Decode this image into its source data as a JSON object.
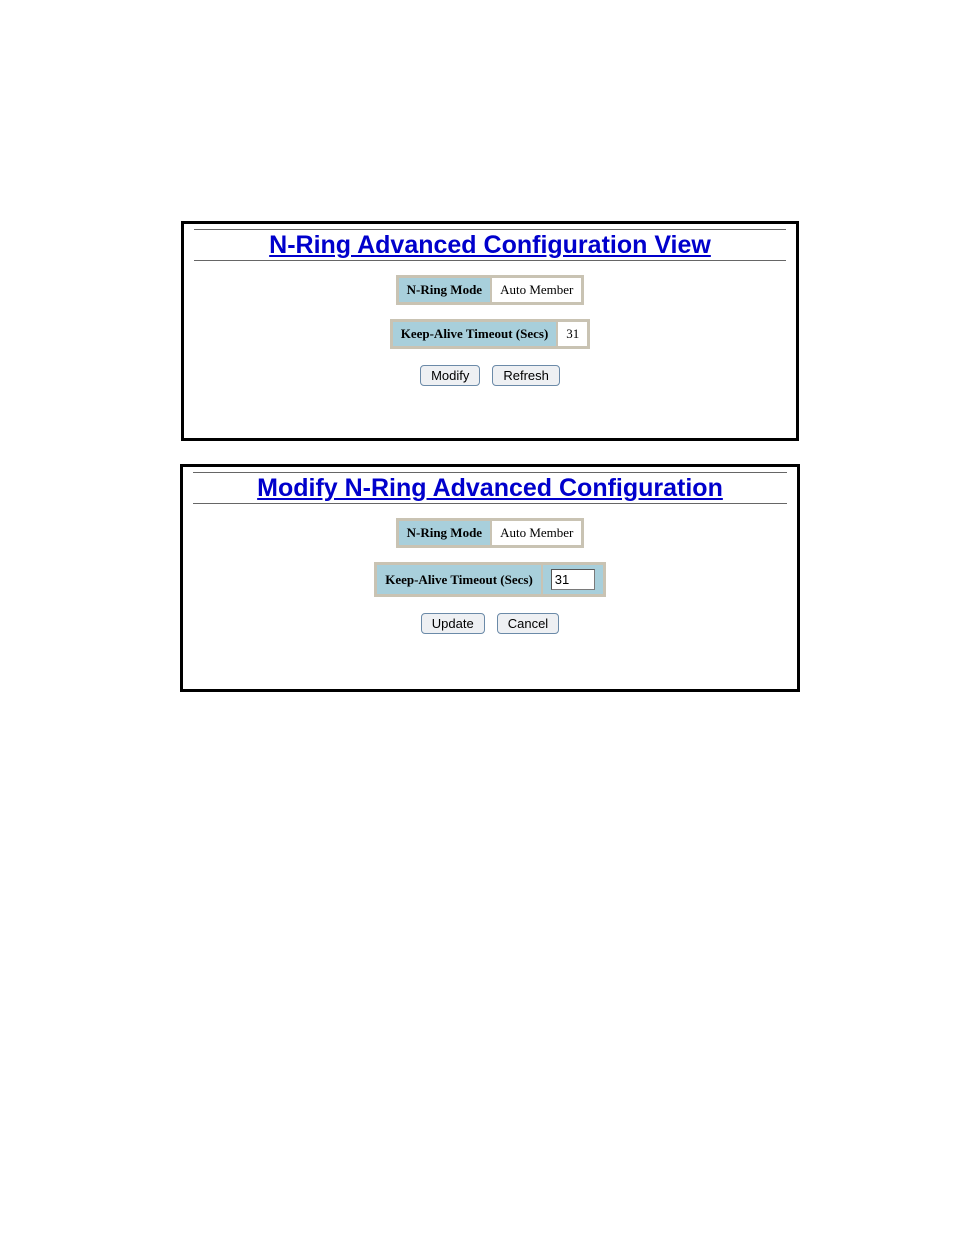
{
  "view_panel": {
    "title": "N-Ring Advanced Configuration View",
    "mode_label": "N-Ring Mode",
    "mode_value": "Auto Member",
    "timeout_label": "Keep-Alive Timeout (Secs)",
    "timeout_value": "31",
    "modify_button": "Modify",
    "refresh_button": "Refresh"
  },
  "modify_panel": {
    "title": "Modify N-Ring Advanced Configuration",
    "mode_label": "N-Ring Mode",
    "mode_value": "Auto Member",
    "timeout_label": "Keep-Alive Timeout (Secs)",
    "timeout_value": "31",
    "update_button": "Update",
    "cancel_button": "Cancel"
  }
}
